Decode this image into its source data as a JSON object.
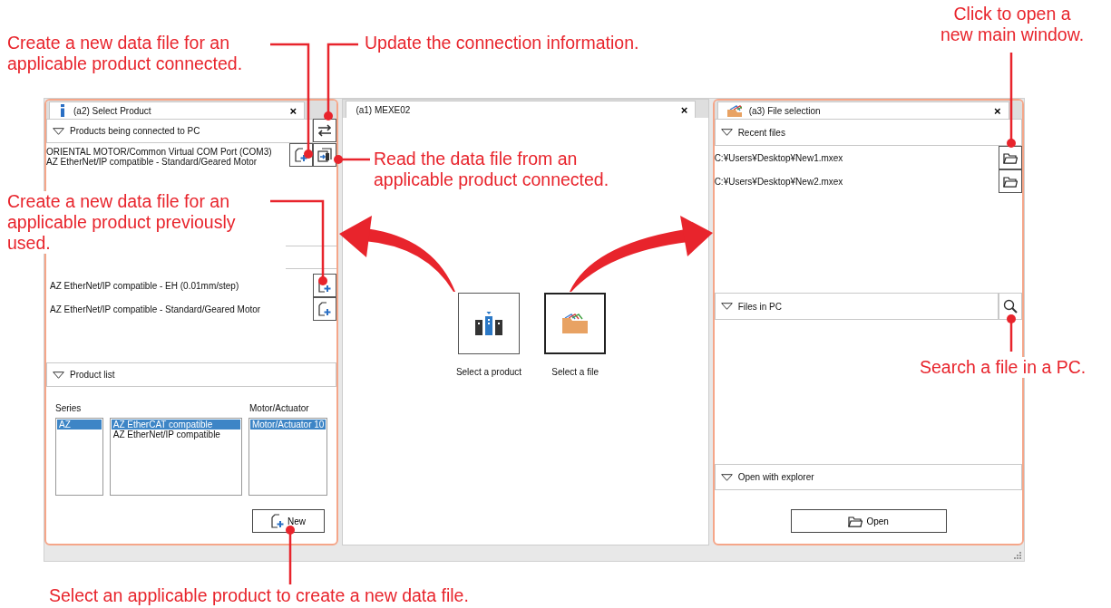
{
  "annotations": [
    {
      "text": "Create a new data file for an applicable product connected."
    },
    {
      "text": "Update the connection information."
    },
    {
      "text": "Click to open a new main window."
    },
    {
      "text": "Read the data file from an applicable product connected."
    },
    {
      "text": "Create a new data file for an applicable product previously used."
    },
    {
      "text": "Search a file in a PC."
    },
    {
      "text": "Select an applicable product to create a new data file."
    }
  ],
  "select_product": {
    "title": "(a2) Select Product",
    "close": "×",
    "connected": {
      "header": "Products being connected to PC",
      "items": [
        {
          "port": "ORIENTAL MOTOR/Common Virtual COM Port (COM3)",
          "product": "AZ EtherNet/IP compatible - Standard/Geared Motor"
        }
      ]
    },
    "previous": {
      "items": [
        "AZ EtherNet/IP compatible - EH (0.01mm/step)",
        "AZ EtherNet/IP compatible - Standard/Geared Motor"
      ]
    },
    "product_list": {
      "header": "Product list",
      "series_label": "Series",
      "motor_label": "Motor/Actuator",
      "series": [
        {
          "text": "AZ",
          "selected": true
        }
      ],
      "products": [
        {
          "text": "AZ EtherCAT compatible",
          "selected": true
        },
        {
          "text": "AZ EtherNet/IP compatible",
          "selected": false
        }
      ],
      "motors": [
        {
          "text": "Motor/Actuator 10",
          "selected": true
        }
      ],
      "new_button": "New"
    }
  },
  "main": {
    "title": "(a1) MEXE02",
    "close": "×",
    "tiles": [
      {
        "kind": "product",
        "label": "Select a product",
        "selected": false
      },
      {
        "kind": "file",
        "label": "Select a file",
        "selected": true
      }
    ]
  },
  "file_selection": {
    "title": "(a3) File selection",
    "close": "×",
    "recent_header": "Recent files",
    "recent_files": [
      "C:¥Users¥Desktop¥New1.mxex",
      "C:¥Users¥Desktop¥New2.mxex"
    ],
    "files_in_pc_header": "Files in PC",
    "explorer_header": "Open with explorer",
    "open_button": "Open"
  }
}
